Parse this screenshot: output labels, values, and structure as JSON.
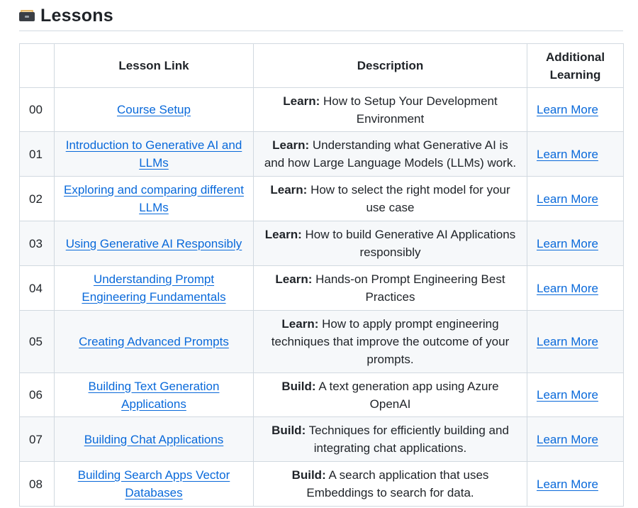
{
  "section": {
    "title": "Lessons",
    "icon": "card-file-box-icon"
  },
  "table": {
    "headers": [
      "",
      "Lesson Link",
      "Description",
      "Additional Learning"
    ],
    "rows": [
      {
        "num": "00",
        "link": "Course Setup",
        "prefix": "Learn:",
        "desc": "How to Setup Your Development Environment",
        "more": "Learn More"
      },
      {
        "num": "01",
        "link": "Introduction to Generative AI and LLMs",
        "prefix": "Learn:",
        "desc": "Understanding what Generative AI is and how Large Language Models (LLMs) work.",
        "more": "Learn More"
      },
      {
        "num": "02",
        "link": "Exploring and comparing different LLMs",
        "prefix": "Learn:",
        "desc": "How to select the right model for your use case",
        "more": "Learn More"
      },
      {
        "num": "03",
        "link": "Using Generative AI Responsibly",
        "prefix": "Learn:",
        "desc": "How to build Generative AI Applications responsibly",
        "more": "Learn More"
      },
      {
        "num": "04",
        "link": "Understanding Prompt Engineering Fundamentals",
        "prefix": "Learn:",
        "desc": "Hands-on Prompt Engineering Best Practices",
        "more": "Learn More"
      },
      {
        "num": "05",
        "link": "Creating Advanced Prompts",
        "prefix": "Learn:",
        "desc": "How to apply prompt engineering techniques that improve the outcome of your prompts.",
        "more": "Learn More"
      },
      {
        "num": "06",
        "link": "Building Text Generation Applications",
        "prefix": "Build:",
        "desc": "A text generation app using Azure OpenAI",
        "more": "Learn More"
      },
      {
        "num": "07",
        "link": "Building Chat Applications",
        "prefix": "Build:",
        "desc": "Techniques for efficiently building and integrating chat applications.",
        "more": "Learn More"
      },
      {
        "num": "08",
        "link": "Building Search Apps Vector Databases",
        "prefix": "Build:",
        "desc": "A search application that uses Embeddings to search for data.",
        "more": "Learn More"
      }
    ]
  },
  "colors": {
    "link": "#0969da",
    "border": "#d1d9e0",
    "stripe": "#f6f8fa",
    "text": "#1f2328"
  }
}
